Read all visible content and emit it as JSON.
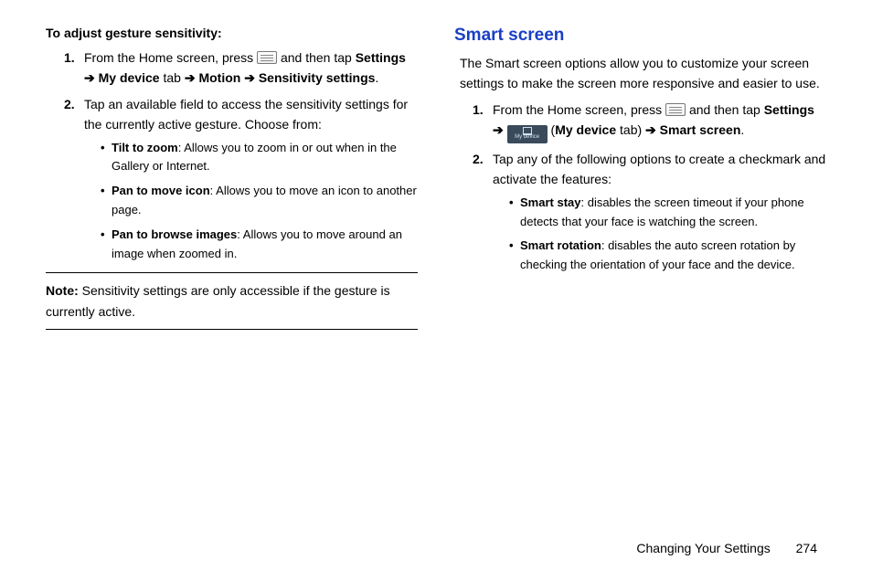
{
  "left": {
    "subhead": "To adjust gesture sensitivity:",
    "step1_a": "From the Home screen, press ",
    "step1_b": " and then tap ",
    "step1_bold1": "Settings",
    "step1_arrow1": "➔",
    "step1_bold2": "My device",
    "step1_tab": " tab ",
    "step1_arrow2": "➔",
    "step1_bold3": "Motion",
    "step1_arrow3": "➔",
    "step1_bold4": "Sensitivity settings",
    "step1_period": ".",
    "step2": "Tap an available field to access the sensitivity settings for the currently active gesture. Choose from:",
    "bullet1_b": "Tilt to zoom",
    "bullet1_t": ": Allows you to zoom in or out when in the Gallery or Internet.",
    "bullet2_b": "Pan to move icon",
    "bullet2_t": ": Allows you to move an icon to another page.",
    "bullet3_b": "Pan to browse images",
    "bullet3_t": ": Allows you to move around an image when zoomed in.",
    "note_label": "Note:",
    "note_text": " Sensitivity settings are only accessible if the gesture is currently active."
  },
  "right": {
    "title": "Smart screen",
    "intro": "The Smart screen options allow you to customize your screen settings to make the screen more responsive and easier to use.",
    "step1_a": "From the Home screen, press ",
    "step1_b": " and then tap ",
    "step1_bold1": "Settings",
    "step1_arrow1": "➔",
    "mydevice_label": "My device",
    "step1_paren_open": " (",
    "step1_bold2": "My device",
    "step1_tab": " tab) ",
    "step1_arrow2": "➔",
    "step1_bold3": "Smart screen",
    "step1_period": ".",
    "step2": "Tap any of the following options to create a checkmark and activate the features:",
    "bullet1_b": "Smart stay",
    "bullet1_t": ": disables the screen timeout if your phone detects that your face is watching the screen.",
    "bullet2_b": "Smart rotation",
    "bullet2_t": ": disables the auto screen rotation by checking the orientation of your face and the device."
  },
  "footer": {
    "section": "Changing Your Settings",
    "page": "274"
  }
}
